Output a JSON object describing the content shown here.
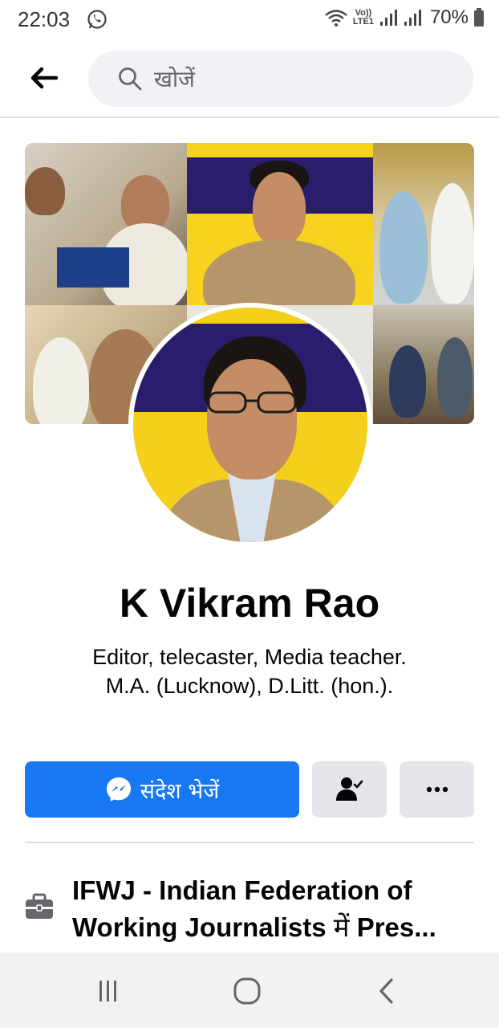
{
  "status_bar": {
    "time": "22:03",
    "network_label_top": "Vo))",
    "network_label_bottom": "LTE1",
    "battery": "70%",
    "icons": [
      "whatsapp-icon",
      "wifi-icon",
      "signal-icon",
      "battery-icon"
    ]
  },
  "header": {
    "back_icon": "arrow-left-icon",
    "search_placeholder": "खोजें"
  },
  "profile": {
    "name": "K Vikram Rao",
    "bio_line1": "Editor, telecaster, Media teacher.",
    "bio_line2": "M.A. (Lucknow), D.Litt. (hon.)."
  },
  "actions": {
    "message_label": "संदेश भेजें",
    "message_icon": "messenger-icon",
    "friend_icon": "friends-check-icon",
    "more_icon": "more-dots-icon"
  },
  "work": {
    "icon": "briefcase-icon",
    "org": "IFWJ - Indian Federation of Working Journalists",
    "connector": "में",
    "role": "Pres..."
  },
  "nav": {
    "icons": [
      "recent-apps-icon",
      "home-icon",
      "back-icon"
    ]
  },
  "colors": {
    "primary": "#1877f2",
    "button_gray": "#e4e6eb",
    "search_bg": "#f0f2f5"
  }
}
